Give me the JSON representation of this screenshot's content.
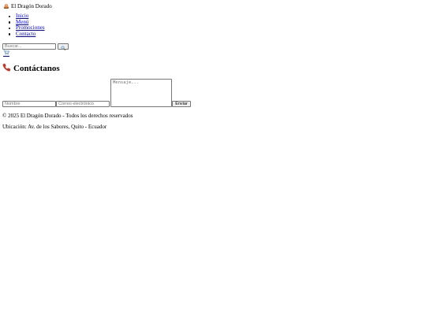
{
  "header": {
    "logo_icon": "restaurant-plate-icon",
    "brand": "El Dragón Dorado"
  },
  "nav": {
    "items": [
      {
        "label": "Inicio"
      },
      {
        "label": "Menú"
      },
      {
        "label": "Promociones"
      },
      {
        "label": "Contacto"
      }
    ]
  },
  "search": {
    "placeholder": "Buscar...",
    "value": "",
    "button_icon": "magnifier-icon"
  },
  "cart": {
    "icon": "shopping-cart-icon"
  },
  "contact": {
    "title_icon": "telephone-icon",
    "title": "Contáctanos",
    "name_placeholder": "Nombre",
    "email_placeholder": "Correo electrónico",
    "message_placeholder": "Mensaje...",
    "submit_label": "Enviar"
  },
  "footer": {
    "copyright": "© 2025 El Dragón Dorado - Todos los derechos reservados",
    "location": "Ubicación: Av. de los Sabores, Quito - Ecuador"
  },
  "colors": {
    "link": "#0000ee",
    "text": "#000000",
    "background": "#ffffff",
    "phone_icon": "#c0392b"
  }
}
